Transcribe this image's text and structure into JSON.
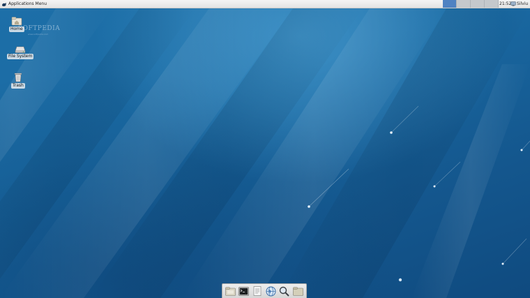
{
  "top_panel": {
    "app_menu_label": "Applications Menu",
    "workspaces": [
      {
        "name": "workspace-1",
        "active": true
      },
      {
        "name": "workspace-2",
        "active": false
      },
      {
        "name": "workspace-3",
        "active": false
      },
      {
        "name": "workspace-4",
        "active": false
      }
    ],
    "clock": "21:52",
    "user": "Silviu"
  },
  "desktop": {
    "watermark": "SOFTPEDIA",
    "watermark_sub": "www.softpedia.com",
    "icons": [
      {
        "label": "Home",
        "icon": "home-folder-icon"
      },
      {
        "label": "File System",
        "icon": "drive-icon"
      },
      {
        "label": "Trash",
        "icon": "trash-icon"
      }
    ]
  },
  "dock": {
    "items": [
      "file-manager-icon",
      "terminal-icon",
      "text-editor-icon",
      "web-browser-icon",
      "search-icon",
      "folder-icon"
    ]
  },
  "colors": {
    "panel": "#e8e8e8",
    "workspace_active": "#4f82c2",
    "desktop_blue": "#1a6aa3"
  }
}
